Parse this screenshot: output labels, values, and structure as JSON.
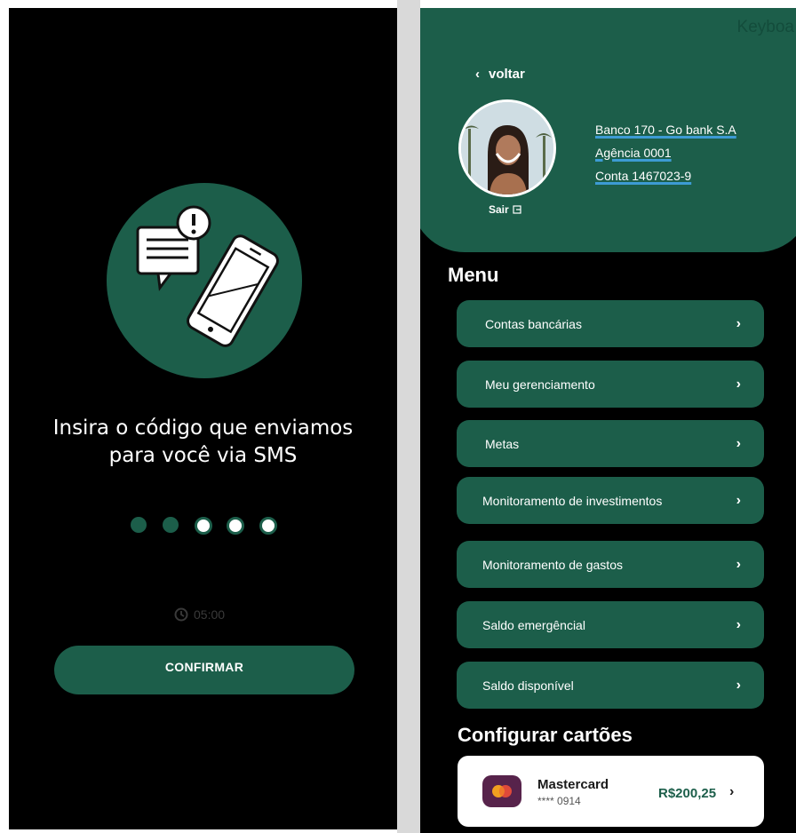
{
  "sms_screen": {
    "prompt_line1": "Insira o código que enviamos",
    "prompt_line2": "para você via SMS",
    "code_dots": [
      {
        "state": "filled"
      },
      {
        "state": "filled"
      },
      {
        "state": "empty"
      },
      {
        "state": "empty"
      },
      {
        "state": "empty"
      }
    ],
    "timer_text": "05:00",
    "confirm_label": "CONFIRMAR",
    "accent_color": "#1c5e4a"
  },
  "menu_screen": {
    "keyboard_hint": "Keyboa",
    "back_label": "voltar",
    "logout_label": "Sair",
    "bank": {
      "line1": "Banco 170 - Go bank S.A",
      "line2": "Agência 0001",
      "line3": "Conta 1467023-9"
    },
    "menu_title": "Menu",
    "menu_items": [
      {
        "label": "Contas bancárias"
      },
      {
        "label": "Meu gerenciamento"
      },
      {
        "label": "Metas"
      },
      {
        "label": "Monitoramento de investimentos"
      },
      {
        "label": "Monitoramento de gastos"
      },
      {
        "label": "Saldo emergêncial"
      },
      {
        "label": "Saldo disponível"
      }
    ],
    "cards_title": "Configurar cartões",
    "card": {
      "name": "Mastercard",
      "number": "**** 0914",
      "amount": "R$200,25"
    }
  }
}
